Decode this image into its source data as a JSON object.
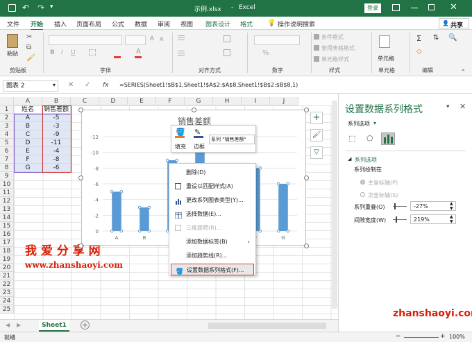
{
  "titlebar": {
    "filename": "示例.xlsx",
    "sep": "-",
    "app": "Excel",
    "login": "登录"
  },
  "tabs": [
    {
      "label": "文件"
    },
    {
      "label": "开始"
    },
    {
      "label": "插入"
    },
    {
      "label": "页面布局"
    },
    {
      "label": "公式"
    },
    {
      "label": "数据"
    },
    {
      "label": "审阅"
    },
    {
      "label": "视图"
    },
    {
      "label": "图表设计"
    },
    {
      "label": "格式"
    }
  ],
  "tellme": "操作说明搜索",
  "share": "共享",
  "ribbon": {
    "paste": "粘贴",
    "clipboard": "剪贴板",
    "font": "字体",
    "align": "对齐方式",
    "number": "数字",
    "styles": "样式",
    "cells": "单元格",
    "editing": "编辑",
    "cond_format": "条件格式",
    "table_format": "套用表格格式",
    "cell_styles": "单元格样式",
    "cells_btn": "单元格",
    "percent": "%"
  },
  "namebox": "图表 2",
  "fx": "fx",
  "formula": "=SERIES(Sheet1!$B$1,Sheet1!$A$2:$A$8,Sheet1!$B$2:$B$8,1)",
  "columns": [
    "A",
    "B",
    "C",
    "D",
    "E",
    "F",
    "G",
    "H",
    "I",
    "J"
  ],
  "rows": [
    "1",
    "2",
    "3",
    "4",
    "5",
    "6",
    "7",
    "8",
    "9",
    "10",
    "11",
    "12",
    "13",
    "14",
    "15",
    "16",
    "17",
    "18",
    "19",
    "20",
    "21",
    "22",
    "23",
    "24",
    "25"
  ],
  "table": {
    "headers": [
      "姓名",
      "销售差额"
    ],
    "names": [
      "A",
      "B",
      "C",
      "D",
      "E",
      "F",
      "G"
    ],
    "values": [
      "-5",
      "-3",
      "-9",
      "-11",
      "-4",
      "-8",
      "-6"
    ]
  },
  "chart_data": {
    "type": "bar",
    "title": "销售差额",
    "categories": [
      "A",
      "B",
      "C",
      "D",
      "E",
      "F",
      "G"
    ],
    "values": [
      -5,
      -3,
      -9,
      -11,
      -4,
      -8,
      -6
    ],
    "ylim": [
      0,
      -12
    ],
    "yticks": [
      "-12",
      "-10",
      "-8",
      "-6",
      "-4",
      "-2",
      "0"
    ],
    "reversed_axis": true,
    "bar_color": "#5b9bd5"
  },
  "mini_toolbar": {
    "fill": "填充",
    "outline": "边框",
    "series_select": "系列 \"销售差额\""
  },
  "context_menu": [
    {
      "label": "删除(D)",
      "icon": "blank-icon",
      "enabled": true
    },
    {
      "label": "重设以匹配样式(A)",
      "icon": "reset-icon",
      "enabled": true
    },
    {
      "label": "更改系列图表类型(Y)...",
      "icon": "chart-type-icon",
      "enabled": true
    },
    {
      "label": "选择数据(E)...",
      "icon": "select-data-icon",
      "enabled": true
    },
    {
      "label": "三维旋转(R)...",
      "icon": "rotate-3d-icon",
      "enabled": false
    },
    {
      "label": "添加数据标签(B)",
      "icon": "blank-icon",
      "enabled": true,
      "submenu": true
    },
    {
      "label": "添加趋势线(R)...",
      "icon": "blank-icon",
      "enabled": true
    },
    {
      "label": "设置数据系列格式(F)...",
      "icon": "format-series-icon",
      "enabled": true,
      "highlighted": true
    }
  ],
  "pane": {
    "title": "设置数据系列格式",
    "series_options_dropdown": "系列选项",
    "section": "系列选项",
    "plot_on": "系列绘制在",
    "primary_axis": "主坐标轴(P)",
    "secondary_axis": "次坐标轴(S)",
    "overlap_label": "系列重叠(O)",
    "overlap_value": "-27%",
    "gap_label": "间隙宽度(W)",
    "gap_value": "219%"
  },
  "sheet_tab": "Sheet1",
  "status": {
    "ready": "就绪",
    "zoom": "100%"
  },
  "watermark1": "我 爱 分 享 网",
  "watermark2": "www.zhanshaoyi.com",
  "watermark3": "zhanshaoyi.com"
}
